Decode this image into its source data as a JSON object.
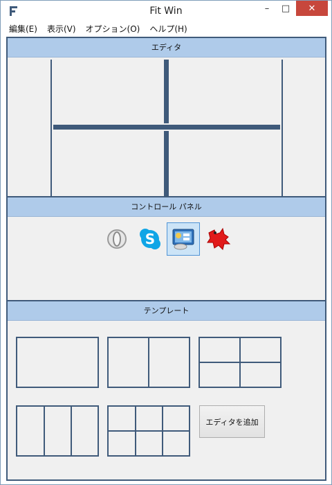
{
  "window": {
    "title": "Fit Win",
    "controls": {
      "minimize": "–",
      "maximize": "□",
      "close": "✕"
    }
  },
  "menu": [
    {
      "label": "編集(E)"
    },
    {
      "label": "表示(V)"
    },
    {
      "label": "オプション(O)"
    },
    {
      "label": "ヘルプ(H)"
    }
  ],
  "editor": {
    "header": "エディタ"
  },
  "control_panel": {
    "header": "コントロール パネル",
    "apps": [
      {
        "icon": "opera-icon",
        "selected": false
      },
      {
        "icon": "skype-icon",
        "selected": false
      },
      {
        "icon": "control-panel-icon",
        "selected": true
      },
      {
        "icon": "red-creature-icon",
        "selected": false
      }
    ]
  },
  "templates": {
    "header": "テンプレート",
    "add_editor_label": "エディタを追加"
  },
  "colors": {
    "accent": "#3f5a7a",
    "header_bg": "#afcbea",
    "close_button": "#c7473c",
    "panel_bg": "#f0f0f0"
  }
}
